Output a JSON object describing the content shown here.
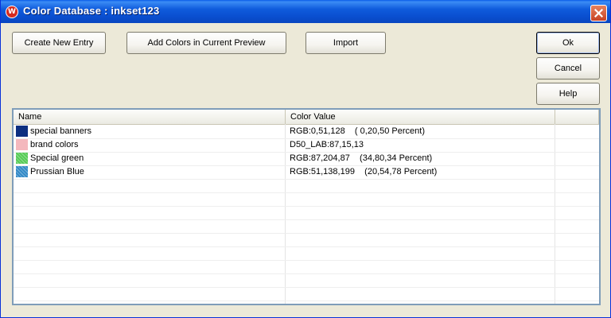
{
  "window": {
    "title": "Color Database : inkset123",
    "app_icon": "app-logo-icon",
    "close_icon": "close-icon"
  },
  "buttons": {
    "create_new_entry": "Create New Entry",
    "add_colors": "Add Colors in Current Preview",
    "import": "Import",
    "ok": "Ok",
    "cancel": "Cancel",
    "help": "Help"
  },
  "table": {
    "columns": [
      "Name",
      "Color Value",
      ""
    ],
    "rows": [
      {
        "name": "special banners",
        "value": "RGB:0,51,128    ( 0,20,50 Percent)",
        "swatch": "#0d2f80",
        "pattern": "solid"
      },
      {
        "name": "brand colors",
        "value": "D50_LAB:87,15,13",
        "swatch": "#f4b8bd",
        "pattern": "solid"
      },
      {
        "name": "Special green",
        "value": "RGB:87,204,87    (34,80,34 Percent)",
        "swatch": "#57cc57",
        "pattern": "dither"
      },
      {
        "name": "Prussian Blue",
        "value": "RGB:51,138,199    (20,54,78 Percent)",
        "swatch": "#338ac7",
        "pattern": "dither"
      }
    ]
  }
}
